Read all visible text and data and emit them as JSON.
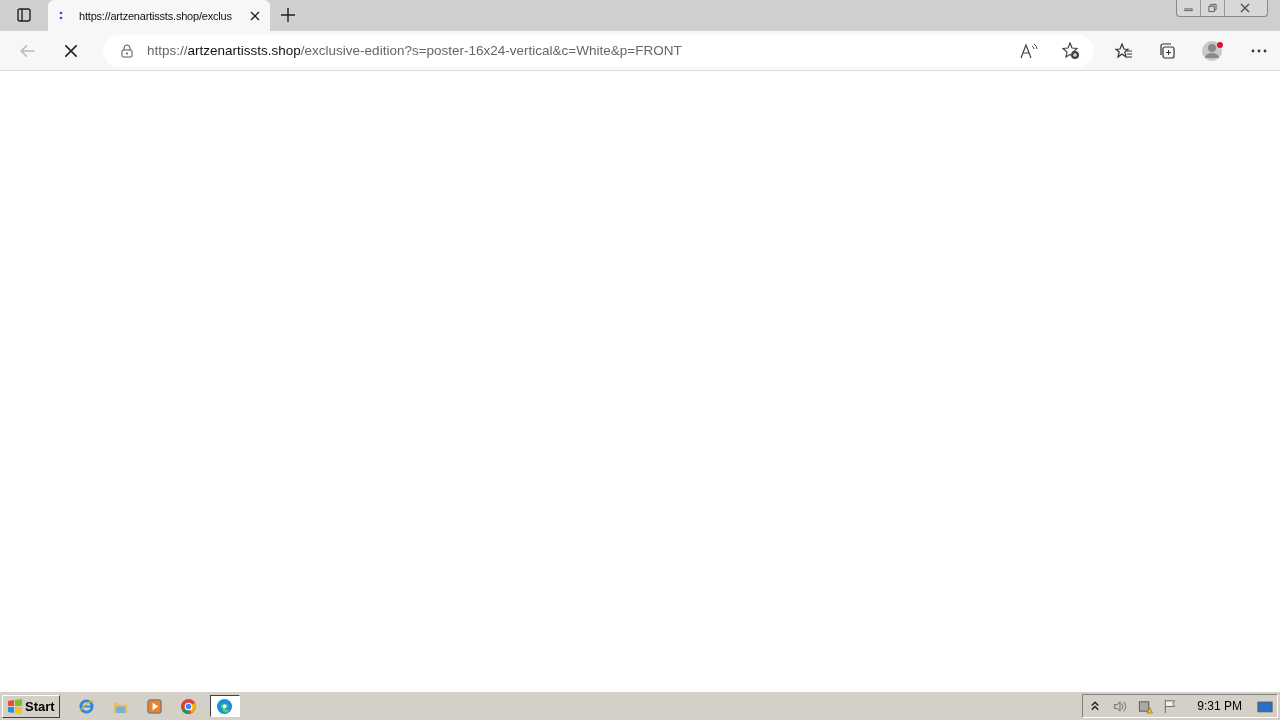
{
  "tabs": [
    {
      "title": "https://artzenartissts.shop/exclus",
      "selected": true
    }
  ],
  "address": {
    "scheme": "https://",
    "host": "artzenartissts.shop",
    "path": "/exclusive-edition?s=poster-16x24-vertical&c=White&p=FRONT"
  },
  "taskbar": {
    "start_label": "Start",
    "apps": [
      {
        "kind": "ie",
        "selected": false
      },
      {
        "kind": "folder",
        "selected": false
      },
      {
        "kind": "media",
        "selected": false
      },
      {
        "kind": "chrome",
        "selected": false
      },
      {
        "kind": "edge",
        "selected": true
      }
    ],
    "clock": "9:31 PM"
  }
}
